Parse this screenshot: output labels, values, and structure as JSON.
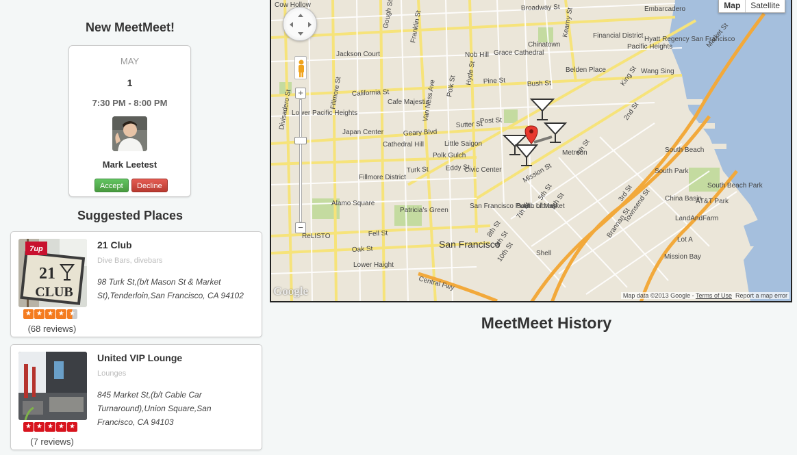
{
  "new_meetmeet": {
    "title": "New MeetMeet!",
    "month": "MAY",
    "day": "1",
    "time": "7:30 PM - 8:00 PM",
    "person": "Mark Leetest",
    "accept_label": "Accept",
    "decline_label": "Decline"
  },
  "suggested": {
    "title": "Suggested Places",
    "places": [
      {
        "name": "21 Club",
        "category": "Dive Bars, divebars",
        "address": "98 Turk St,(b/t Mason St & Market St),Tenderloin,San Francisco, CA 94102",
        "reviews": "(68 reviews)",
        "rating": 4.5,
        "star_color": "#f47c20",
        "sign_text_top": "7up",
        "sign_text_main": "21",
        "sign_text_sub": "CLUB"
      },
      {
        "name": "United VIP Lounge",
        "category": "Lounges",
        "address": "845 Market St,(b/t Cable Car Turnaround),Union Square,San Francisco, CA 94103",
        "reviews": "(7 reviews)",
        "rating": 5,
        "star_color": "#d8141e"
      }
    ]
  },
  "map": {
    "type_map": "Map",
    "type_satellite": "Satellite",
    "attribution": "Map data ©2013 Google",
    "terms": "Terms of Use",
    "report": "Report a map error",
    "logo": "Google",
    "labels": [
      "Cow Hollow",
      "Embarcadero",
      "Broadway St",
      "Financial District",
      "Hyatt Regency San Francisco",
      "Chinatown",
      "Nob Hill",
      "Grace Cathedral",
      "Jackson Court",
      "Pacific Heights",
      "Belden Place",
      "Wang Sing",
      "Lower Pacific Heights",
      "Japan Center",
      "Cathedral Hill",
      "Little Saigon",
      "Polk Gulch",
      "Civic Center",
      "Fillmore District",
      "Metreon",
      "South Beach",
      "South Park",
      "South Beach Park",
      "China Basin",
      "AT&T Park",
      "LandAndFarm",
      "Alamo Square",
      "Patricia's Green",
      "San Francisco Public Library",
      "South of Market",
      "San Francisco",
      "Lower Haight",
      "Mission Bay",
      "Lot A",
      "Shell",
      "Cafe Majestic",
      "ReLISTO",
      "Central Fwy",
      "Mission St",
      "Market St",
      "Geary Blvd",
      "Turk St",
      "Fell St",
      "Oak St",
      "California St",
      "Pine St",
      "Bush St",
      "Sutter St",
      "Post St",
      "Eddy St",
      "Fillmore St",
      "Divisadero St",
      "Van Ness Ave",
      "Franklin St",
      "Gough St",
      "Polk St",
      "Hyde St",
      "Kearny St",
      "Brannan St",
      "Townsend St",
      "4th St",
      "5th St",
      "6th St",
      "7th St",
      "8th St",
      "9th St",
      "10th St",
      "3rd St",
      "2nd St",
      "King St"
    ]
  },
  "history_title": "MeetMeet History"
}
